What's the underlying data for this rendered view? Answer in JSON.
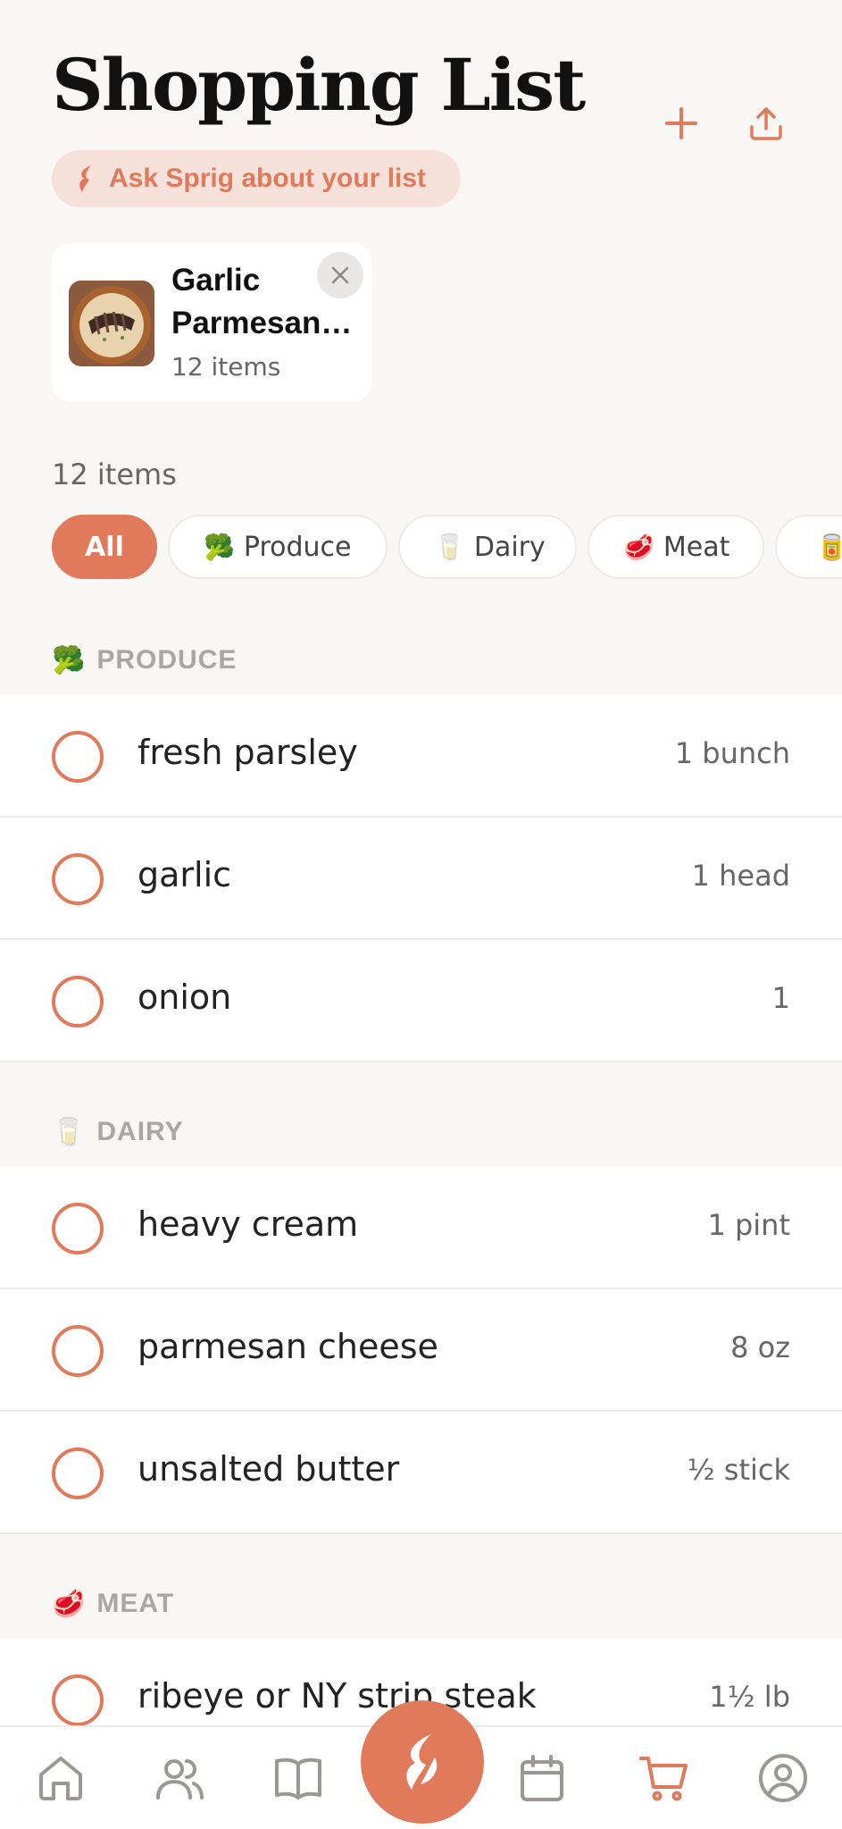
{
  "header": {
    "title": "Shopping List",
    "ask_label": "Ask Sprig about your list"
  },
  "recipe": {
    "name_line1": "Garlic",
    "name_line2": "Parmesan…",
    "count": "12 items"
  },
  "summary": {
    "count": "12 items"
  },
  "filters": [
    {
      "label": "All",
      "icon": ""
    },
    {
      "label": "Produce",
      "icon": "🥦"
    },
    {
      "label": "Dairy",
      "icon": "🥛"
    },
    {
      "label": "Meat",
      "icon": "🥩"
    },
    {
      "label": "",
      "icon": "🥫"
    }
  ],
  "sections": {
    "produce": {
      "icon": "🥦",
      "title": "PRODUCE",
      "items": [
        {
          "name": "fresh parsley",
          "qty": "1 bunch"
        },
        {
          "name": "garlic",
          "qty": "1 head"
        },
        {
          "name": "onion",
          "qty": "1"
        }
      ]
    },
    "dairy": {
      "icon": "🥛",
      "title": "DAIRY",
      "items": [
        {
          "name": "heavy cream",
          "qty": "1 pint"
        },
        {
          "name": "parmesan cheese",
          "qty": "8 oz"
        },
        {
          "name": "unsalted butter",
          "qty": "½ stick"
        }
      ]
    },
    "meat": {
      "icon": "🥩",
      "title": "MEAT",
      "items": [
        {
          "name": "ribeye or NY strip steak",
          "qty": "1½ lb"
        }
      ]
    }
  },
  "nav": {
    "icons": [
      "home-icon",
      "people-icon",
      "book-icon",
      "sprig-icon",
      "calendar-icon",
      "cart-icon",
      "profile-icon"
    ],
    "active": "cart-icon"
  },
  "colors": {
    "accent": "#e07a5a",
    "accent_soft": "#f6e2da",
    "background": "#f8f7f6",
    "muted_text": "#a9a6a3"
  }
}
